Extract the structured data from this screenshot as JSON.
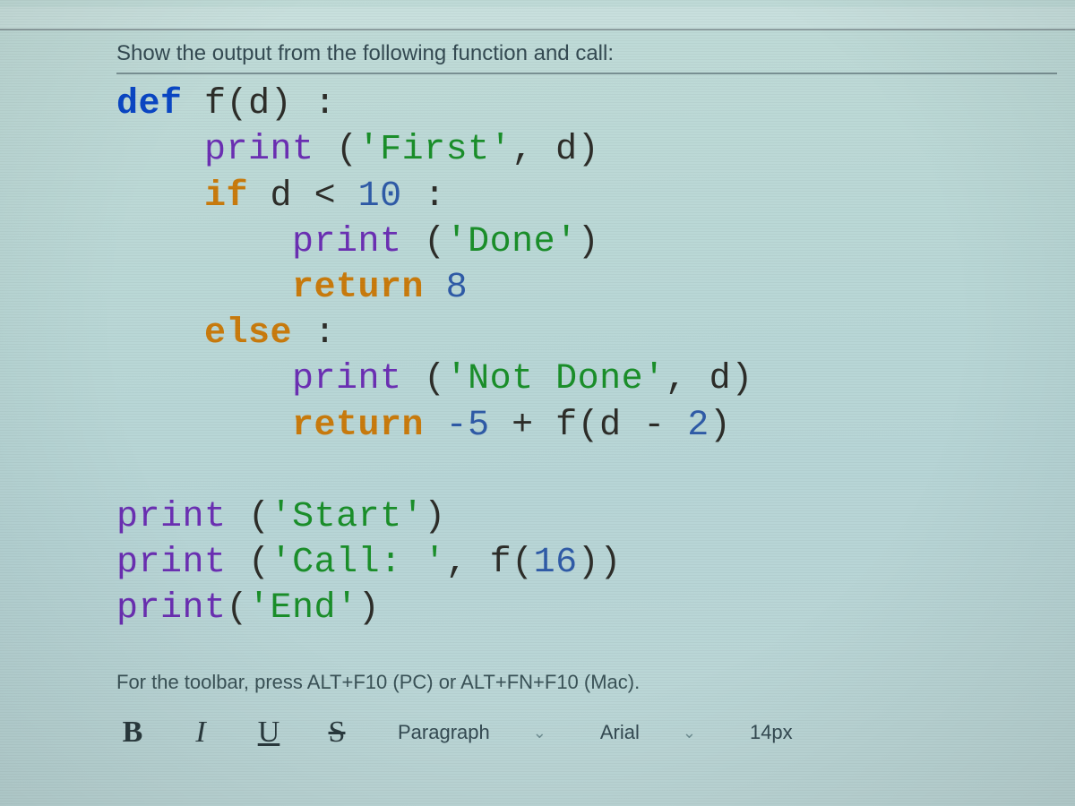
{
  "question": {
    "prompt": "Show the output from the following function and call:"
  },
  "code": {
    "kw_def": "def",
    "fn_name": "f",
    "param": "d",
    "colon": ":",
    "print": "print",
    "first_str": "'First'",
    "if_kw": "if",
    "cond_var": "d",
    "lt": "<",
    "ten": "10",
    "done_str": "'Done'",
    "return_kw": "return",
    "eight": "8",
    "else_kw": "else",
    "notdone_str": "'Not Done'",
    "neg5": "-5",
    "plus": "+",
    "minus": "-",
    "two": "2",
    "start_str": "'Start'",
    "call_str": "'Call: '",
    "sixteen": "16",
    "end_str": "'End'",
    "comma": ",",
    "lparen": "(",
    "rparen": ")"
  },
  "hint": "For the toolbar, press ALT+F10 (PC) or ALT+FN+F10 (Mac).",
  "toolbar": {
    "bold": "B",
    "italic": "I",
    "underline": "U",
    "strike": "S",
    "block_format": "Paragraph",
    "font_family": "Arial",
    "font_size": "14px"
  }
}
